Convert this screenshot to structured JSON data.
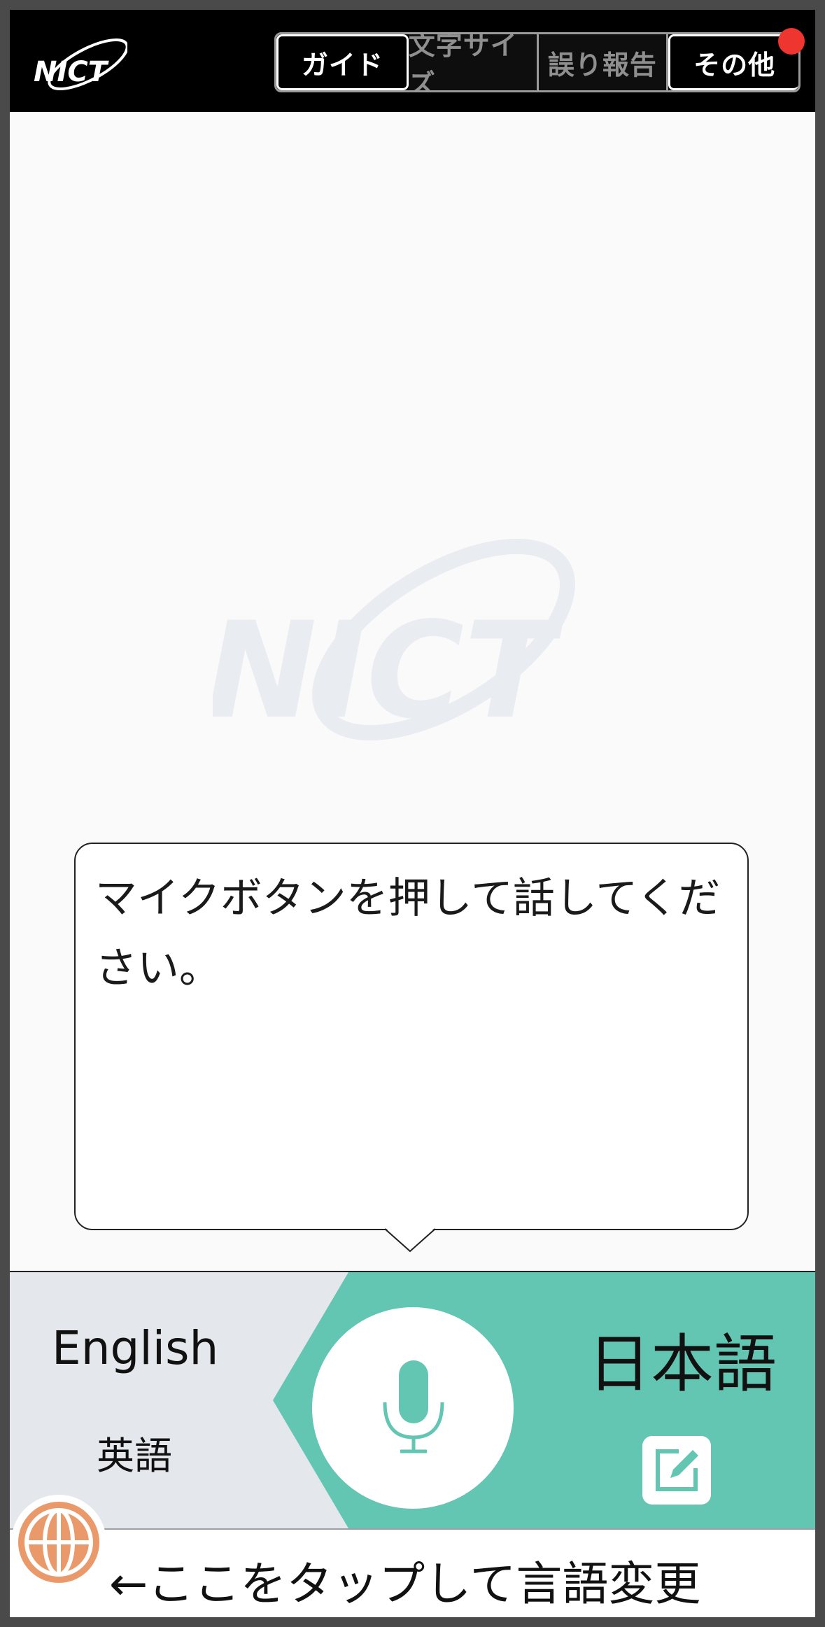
{
  "header": {
    "logo_text": "NICT",
    "buttons": [
      {
        "label": "ガイド"
      },
      {
        "label": "文字サイズ"
      },
      {
        "label": "誤り報告"
      },
      {
        "label": "その他"
      }
    ],
    "badge_color": "#ee3530"
  },
  "prompt": {
    "message": "マイクボタンを押して話してください。"
  },
  "languages": {
    "source": {
      "name": "English",
      "native_name": "英語"
    },
    "target": {
      "name": "日本語"
    },
    "mic_icon": "microphone-icon",
    "edit_icon": "edit-icon",
    "accent_color": "#63c6b3",
    "source_bg": "#e4e7eb"
  },
  "footer": {
    "hint": "←ここをタップして言語変更",
    "globe_icon": "globe-icon",
    "globe_color": "#ea9a6a"
  }
}
